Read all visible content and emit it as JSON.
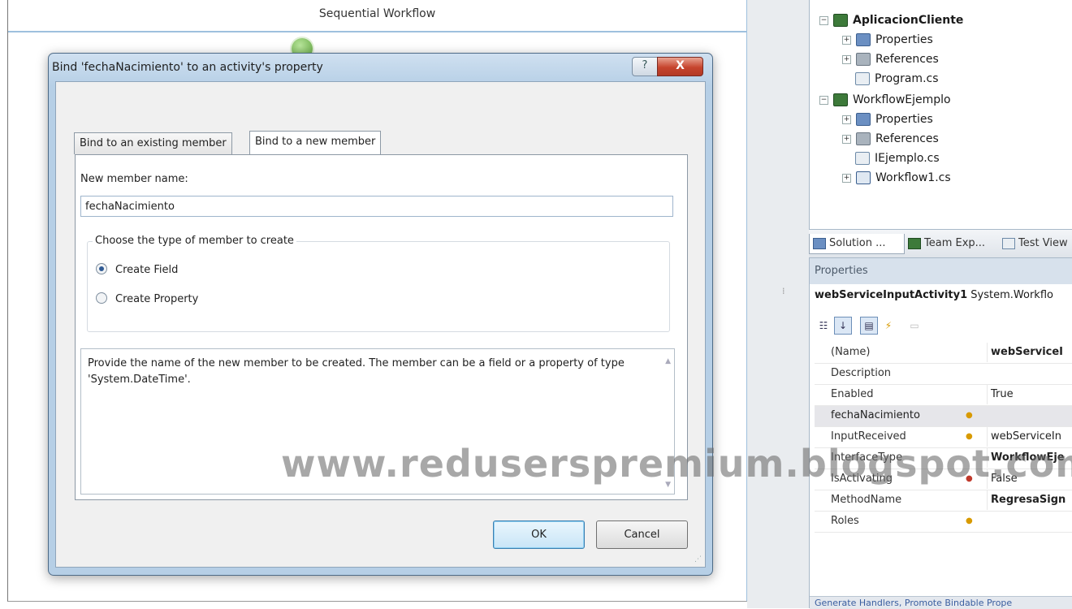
{
  "designer": {
    "title": "Sequential Workflow"
  },
  "dialog": {
    "title": "Bind 'fechaNacimiento' to an activity's property",
    "help_glyph": "?",
    "close_glyph": "X",
    "tabs": [
      {
        "label": "Bind to an existing member",
        "active": false
      },
      {
        "label": "Bind to a new member",
        "active": true
      }
    ],
    "member_label": "New member name:",
    "member_value": "fechaNacimiento",
    "group_legend": "Choose the type of member to create",
    "options": [
      {
        "label": "Create Field",
        "checked": true
      },
      {
        "label": "Create Property",
        "checked": false
      }
    ],
    "description": "Provide the name of the new member to be created. The member can be a field or a property of type 'System.DateTime'.",
    "ok_label": "OK",
    "cancel_label": "Cancel"
  },
  "solution_explorer": {
    "items": [
      {
        "label": "AplicacionCliente",
        "expander": "−",
        "icon": "csharp-project-icon",
        "bold": true
      },
      {
        "label": "Properties",
        "expander": "+",
        "icon": "properties-folder-icon",
        "bold": false
      },
      {
        "label": "References",
        "expander": "+",
        "icon": "references-icon",
        "bold": false
      },
      {
        "label": "Program.cs",
        "expander": "",
        "icon": "cs-file-icon",
        "bold": false
      },
      {
        "label": "WorkflowEjemplo",
        "expander": "−",
        "icon": "csharp-project-icon",
        "bold": false
      },
      {
        "label": "Properties",
        "expander": "+",
        "icon": "properties-folder-icon",
        "bold": false
      },
      {
        "label": "References",
        "expander": "+",
        "icon": "references-icon",
        "bold": false
      },
      {
        "label": "IEjemplo.cs",
        "expander": "",
        "icon": "cs-file-icon",
        "bold": false
      },
      {
        "label": "Workflow1.cs",
        "expander": "+",
        "icon": "workflow-file-icon",
        "bold": false
      }
    ],
    "tabs": [
      "Solution ...",
      "Team Exp...",
      "Test View"
    ]
  },
  "properties": {
    "pane_title": "Properties",
    "object_name": "webServiceInputActivity1",
    "object_type": "System.Workflo",
    "rows": [
      {
        "name": "(Name)",
        "indicator": "",
        "value": "webServiceI",
        "value_bold": true
      },
      {
        "name": "Description",
        "indicator": "",
        "value": "",
        "value_bold": false
      },
      {
        "name": "Enabled",
        "indicator": "",
        "value": "True",
        "value_bold": false
      },
      {
        "name": "fechaNacimiento",
        "indicator": "●",
        "value": "",
        "value_bold": false,
        "highlight": true
      },
      {
        "name": "InputReceived",
        "indicator": "●",
        "value": "webServiceIn",
        "value_bold": false
      },
      {
        "name": "InterfaceType",
        "indicator": "",
        "value": "WorkflowEje",
        "value_bold": true
      },
      {
        "name": "IsActivating",
        "indicator": "●",
        "value": "False",
        "value_bold": false
      },
      {
        "name": "MethodName",
        "indicator": "",
        "value": "RegresaSign",
        "value_bold": true
      },
      {
        "name": "Roles",
        "indicator": "●",
        "value": "",
        "value_bold": false
      }
    ],
    "footer_text": "Generate Handlers, Promote Bindable Prope"
  },
  "watermark": "www.reduserspremium.blogspot.com"
}
